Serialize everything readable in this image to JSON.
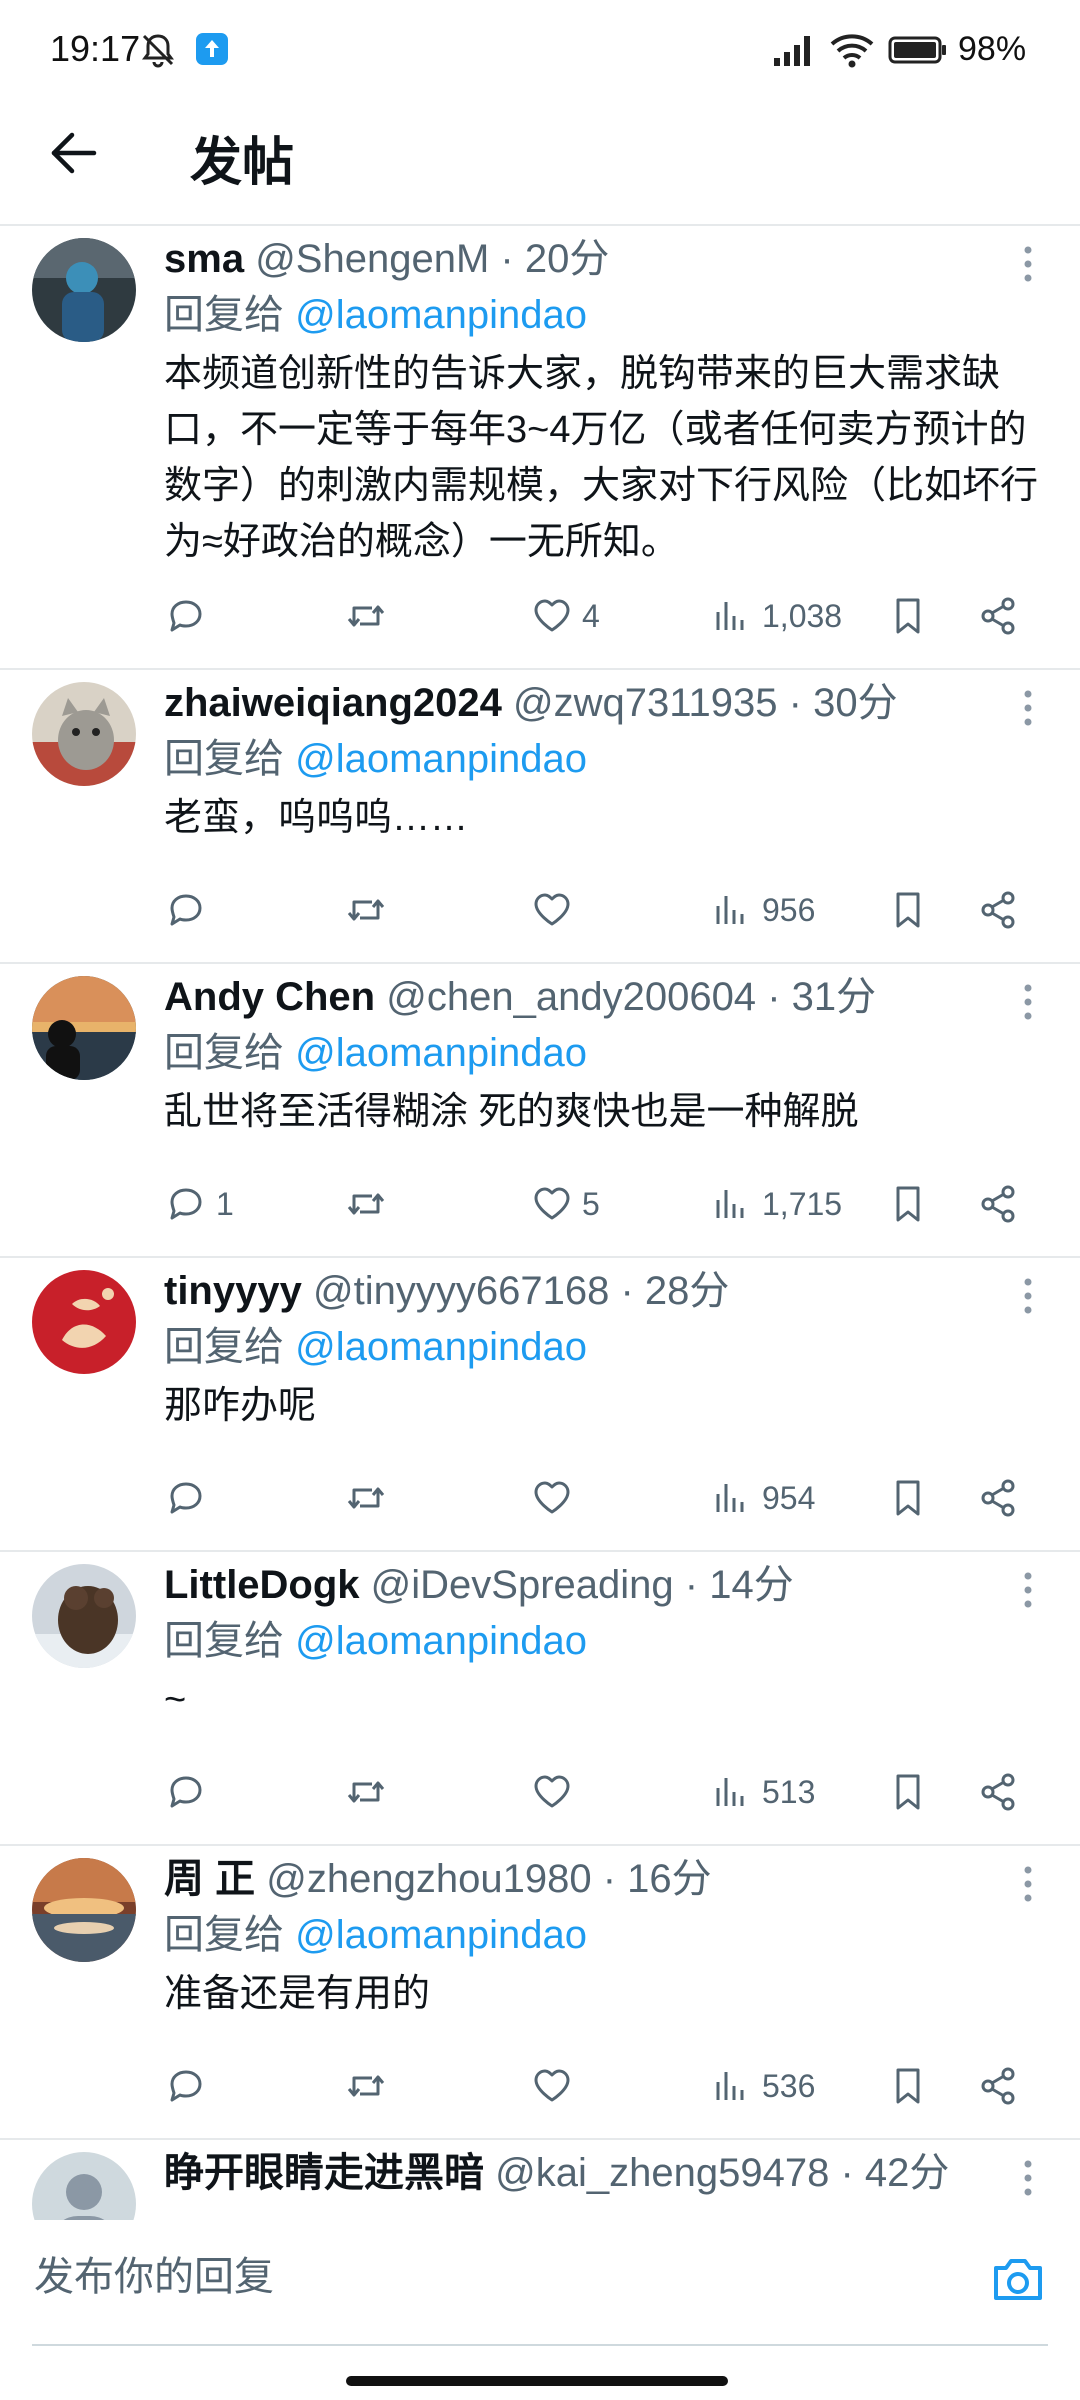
{
  "status_bar": {
    "time": "19:17",
    "battery_pct": "98%",
    "icons": [
      "mute-icon",
      "app-notification-icon",
      "signal-icon",
      "wifi-icon",
      "battery-icon"
    ]
  },
  "header": {
    "title": "发帖",
    "back_icon": "arrow-left-icon"
  },
  "replies": [
    {
      "name": "sma",
      "handle": "@ShengenM",
      "time": "· 20分",
      "reply_to_label": "回复给",
      "reply_to": "@laomanpindao",
      "text": "本频道创新性的告诉大家，脱钩带来的巨大需求缺口，不一定等于每年3~4万亿（或者任何卖方预计的数字）的刺激内需规模，大家对下行风险（比如坏行为≈好政治的概念）一无所知。",
      "replies": "",
      "retweets": "",
      "likes": "4",
      "views": "1,038"
    },
    {
      "name": "zhaiweiqiang2024",
      "handle": "@zwq7311935",
      "time": "· 30分",
      "reply_to_label": "回复给",
      "reply_to": "@laomanpindao",
      "text": "老蛮，呜呜呜……",
      "replies": "",
      "retweets": "",
      "likes": "",
      "views": "956"
    },
    {
      "name": "Andy Chen",
      "handle": "@chen_andy200604",
      "time": "· 31分",
      "reply_to_label": "回复给",
      "reply_to": "@laomanpindao",
      "text": "乱世将至活得糊涂 死的爽快也是一种解脱",
      "replies": "1",
      "retweets": "",
      "likes": "5",
      "views": "1,715"
    },
    {
      "name": "tinyyyy",
      "handle": "@tinyyyy667168",
      "time": "· 28分",
      "reply_to_label": "回复给",
      "reply_to": "@laomanpindao",
      "text": "那咋办呢",
      "replies": "",
      "retweets": "",
      "likes": "",
      "views": "954"
    },
    {
      "name": "LittleDogk",
      "handle": "@iDevSpreading",
      "time": "· 14分",
      "reply_to_label": "回复给",
      "reply_to": "@laomanpindao",
      "text": "~",
      "replies": "",
      "retweets": "",
      "likes": "",
      "views": "513"
    },
    {
      "name": "周 正",
      "handle": "@zhengzhou1980",
      "time": "· 16分",
      "reply_to_label": "回复给",
      "reply_to": "@laomanpindao",
      "text": "准备还是有用的",
      "replies": "",
      "retweets": "",
      "likes": "",
      "views": "536"
    },
    {
      "name": "睁开眼睛走进黑暗",
      "handle": "@kai_zheng59478",
      "time": "· 42分",
      "reply_to_label": "",
      "reply_to": "",
      "text": "",
      "replies": "",
      "retweets": "",
      "likes": "",
      "views": ""
    }
  ],
  "composer": {
    "placeholder": "发布你的回复",
    "camera_icon": "camera-icon"
  },
  "colors": {
    "accent": "#1d9bf0",
    "text": "#0f1419",
    "secondary": "#536471",
    "divider": "#e6e9eb"
  }
}
